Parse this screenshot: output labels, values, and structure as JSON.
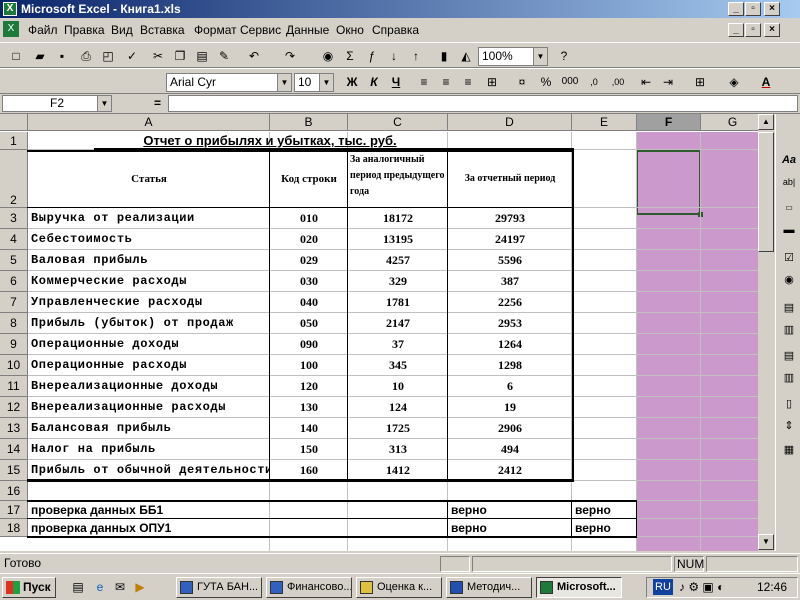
{
  "window": {
    "title": "Microsoft Excel - Книга1.xls"
  },
  "menu": [
    "Файл",
    "Правка",
    "Вид",
    "Вставка",
    "Формат",
    "Сервис",
    "Данные",
    "Окно",
    "Справка"
  ],
  "toolbar": {
    "zoom": "100%"
  },
  "format_bar": {
    "font": "Arial Cyr",
    "size": "10",
    "bold_label": "Ж",
    "italic_label": "К",
    "underline_label": "Ч"
  },
  "formula_bar": {
    "name_box": "F2",
    "equals": "=",
    "content": ""
  },
  "columns": [
    "A",
    "B",
    "C",
    "D",
    "E",
    "F",
    "G"
  ],
  "rows": [
    "1",
    "2",
    "3",
    "4",
    "5",
    "6",
    "7",
    "8",
    "9",
    "10",
    "11",
    "12",
    "13",
    "14",
    "15",
    "16",
    "17",
    "18"
  ],
  "sheet": {
    "title": "Отчет о прибылях и убытках, тыс. руб.",
    "headers": {
      "a": "Статья",
      "b": "Код строки",
      "c": "За аналогичный период предыдущего года",
      "d": "За отчетный период"
    },
    "data": [
      {
        "name": "Выручка от реализации",
        "code": "010",
        "prev": "18172",
        "cur": "29793"
      },
      {
        "name": "Себестоимость",
        "code": "020",
        "prev": "13195",
        "cur": "24197"
      },
      {
        "name": "Валовая прибыль",
        "code": "029",
        "prev": "4257",
        "cur": "5596"
      },
      {
        "name": "Коммерческие расходы",
        "code": "030",
        "prev": "329",
        "cur": "387"
      },
      {
        "name": "Управленческие расходы",
        "code": "040",
        "prev": "1781",
        "cur": "2256"
      },
      {
        "name": "Прибыль (убыток) от продаж",
        "code": "050",
        "prev": "2147",
        "cur": "2953"
      },
      {
        "name": "Операционные доходы",
        "code": "090",
        "prev": "37",
        "cur": "1264"
      },
      {
        "name": "Операционные расходы",
        "code": "100",
        "prev": "345",
        "cur": "1298"
      },
      {
        "name": "Внереализационные доходы",
        "code": "120",
        "prev": "10",
        "cur": "6"
      },
      {
        "name": "Внереализационные расходы",
        "code": "130",
        "prev": "124",
        "cur": "19"
      },
      {
        "name": "Балансовая прибыль",
        "code": "140",
        "prev": "1725",
        "cur": "2906"
      },
      {
        "name": "Налог на прибыль",
        "code": "150",
        "prev": "313",
        "cur": "494"
      },
      {
        "name": "Прибыль от обычной деятельности",
        "code": "160",
        "prev": "1412",
        "cur": "2412"
      }
    ],
    "checks": [
      {
        "label": "проверка данных ББ1",
        "d": "верно",
        "e": "верно"
      },
      {
        "label": "проверка данных ОПУ1",
        "d": "верно",
        "e": "верно"
      }
    ]
  },
  "status": {
    "ready": "Готово",
    "num": "NUM"
  },
  "taskbar": {
    "start": "Пуск",
    "tasks": [
      "ГУТА БАН...",
      "Финансово...",
      "Оценка к...",
      "Методич...",
      "Microsoft..."
    ],
    "lang": "RU",
    "time": "12:46"
  },
  "colors": {
    "selection_fill": "#cc99cc",
    "title_bar": "#0a246a",
    "active_cell_border": "#2e5a2e"
  }
}
